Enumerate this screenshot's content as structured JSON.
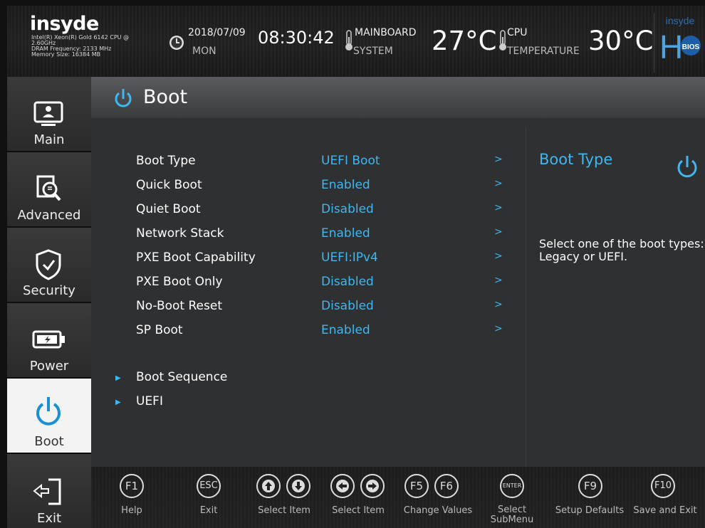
{
  "header": {
    "brand": "insyde",
    "cpu_info": "Intel(R) Xeon(R) Gold 6142 CPU @",
    "cpu_freq": "2.60GHz",
    "dram": "DRAM Frequency: 2133 MHz",
    "memory": "Memory Size: 16384 MB",
    "date": "2018/07/09",
    "day": "MON",
    "time": "08:30:42",
    "mainboard_label1": "MAINBOARD",
    "mainboard_label2": "SYSTEM",
    "mainboard_temp": "27°C",
    "cpu_label1": "CPU",
    "cpu_label2": "TEMPERATURE",
    "cpu_temp": "30°C",
    "logo_top": "insyde",
    "logo_bios": "BIOS"
  },
  "sidebar": {
    "items": [
      {
        "label": "Main",
        "icon": "monitor-icon"
      },
      {
        "label": "Advanced",
        "icon": "magnify-icon"
      },
      {
        "label": "Security",
        "icon": "shield-icon"
      },
      {
        "label": "Power",
        "icon": "battery-icon"
      },
      {
        "label": "Boot",
        "icon": "power-icon",
        "active": true
      },
      {
        "label": "Exit",
        "icon": "exit-icon"
      }
    ]
  },
  "page": {
    "title": "Boot",
    "settings": [
      {
        "label": "Boot Type",
        "value": "UEFI Boot",
        "arrow": ">"
      },
      {
        "label": "Quick Boot",
        "value": "Enabled",
        "arrow": ">"
      },
      {
        "label": "Quiet Boot",
        "value": "Disabled",
        "arrow": ">"
      },
      {
        "label": "Network Stack",
        "value": "Enabled",
        "arrow": ">"
      },
      {
        "label": "PXE Boot Capability",
        "value": "UEFI:IPv4",
        "arrow": ">"
      },
      {
        "label": "PXE Boot Only",
        "value": "Disabled",
        "arrow": ">"
      },
      {
        "label": "No-Boot Reset",
        "value": "Disabled",
        "arrow": ">"
      },
      {
        "label": "SP Boot",
        "value": "Enabled",
        "arrow": ">"
      }
    ],
    "submenus": [
      {
        "label": "Boot Sequence"
      },
      {
        "label": "UEFI"
      }
    ]
  },
  "help": {
    "title": "Boot Type",
    "text": "Select one of the boot types: Legacy or UEFI."
  },
  "footer": {
    "keys": {
      "f1": "F1",
      "esc": "ESC",
      "f5": "F5",
      "f6": "F6",
      "enter": "ENTER",
      "f9": "F9",
      "f10": "F10"
    },
    "labels": {
      "help": "Help",
      "exit": "Exit",
      "select_item_ud": "Select Item",
      "select_item_lr": "Select Item",
      "change_values": "Change Values",
      "select_submenu_1": "Select",
      "select_submenu_2": "SubMenu",
      "setup_defaults": "Setup Defaults",
      "save_exit": "Save and Exit"
    }
  },
  "colors": {
    "accent": "#3fb7ef",
    "panel": "#2f3032",
    "active_nav": "#f3f3f3"
  }
}
